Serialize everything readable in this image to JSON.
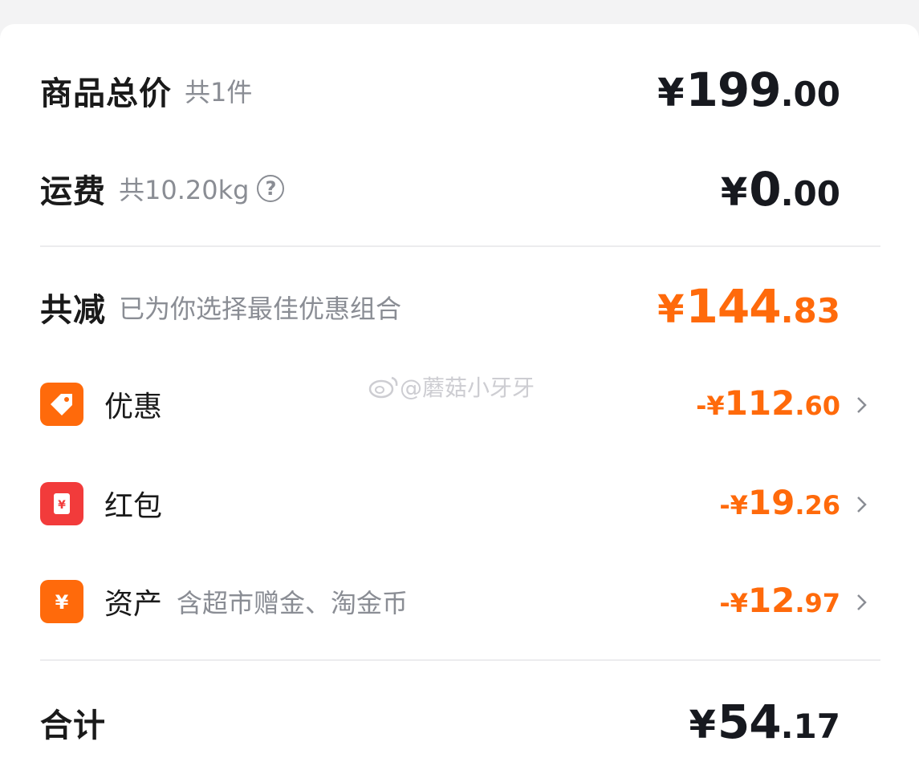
{
  "summary": {
    "goods_total": {
      "label": "商品总价",
      "sub": "共1件",
      "currency": "¥",
      "int": "199",
      "dec": ".00"
    },
    "shipping": {
      "label": "运费",
      "sub": "共10.20kg",
      "help_icon": "question-circle-icon",
      "currency": "¥",
      "int": "0",
      "dec": ".00"
    },
    "discount_total": {
      "label": "共减",
      "sub": "已为你选择最佳优惠组合",
      "currency": "¥",
      "int": "144",
      "dec": ".83"
    },
    "items": [
      {
        "icon": "tag-icon",
        "icon_color": "#ff6a0b",
        "label": "优惠",
        "sub": "",
        "prefix": "-¥",
        "int": "112",
        "dec": ".60"
      },
      {
        "icon": "red-packet-icon",
        "icon_color": "#f23b3b",
        "label": "红包",
        "sub": "",
        "prefix": "-¥",
        "int": "19",
        "dec": ".26"
      },
      {
        "icon": "yuan-coin-icon",
        "icon_color": "#ff6a0b",
        "label": "资产",
        "sub": "含超市赠金、淘金币",
        "prefix": "-¥",
        "int": "12",
        "dec": ".97"
      }
    ],
    "total": {
      "label": "合计",
      "currency": "¥",
      "int": "54",
      "dec": ".17"
    }
  },
  "watermark": {
    "text": "@蘑菇小牙牙",
    "icon": "weibo-icon"
  },
  "colors": {
    "accent": "#ff6a0b",
    "red": "#f23b3b",
    "text": "#17191f",
    "muted": "#8a8d94"
  }
}
